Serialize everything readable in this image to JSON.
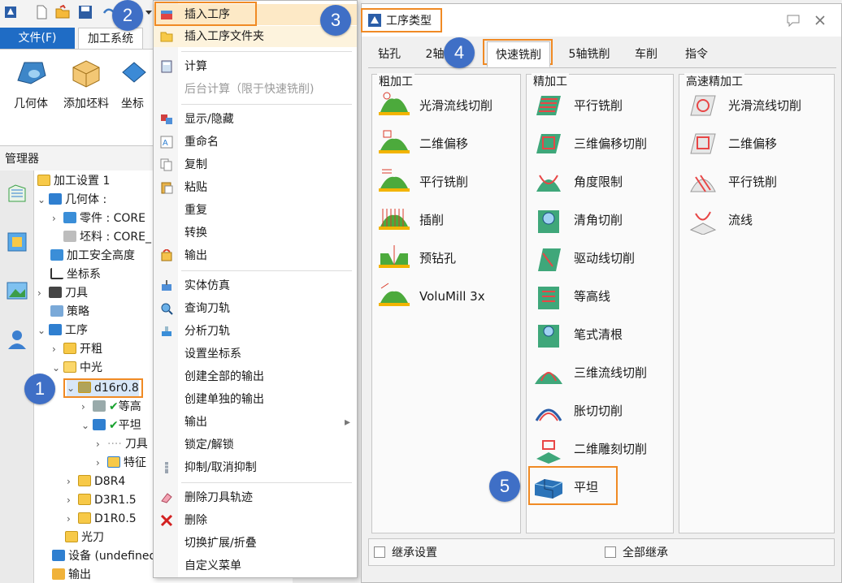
{
  "ribbon": {
    "tabs": [
      "文件(F)",
      "加工系统"
    ],
    "buttons": [
      "几何体",
      "添加坯料",
      "坐标"
    ]
  },
  "manager": {
    "title": "管理器",
    "tree": [
      "加工设置 1",
      "几何体 :",
      "零件 : CORE",
      "坯料 : CORE_",
      "加工安全高度",
      "坐标系",
      "刀具",
      "策略",
      "工序",
      "开粗",
      "中光",
      "d16r0.8",
      "等高",
      "平坦",
      "刀具",
      "特征",
      "D8R4",
      "D3R1.5",
      "D1R0.5",
      "光刀",
      "设备 (undefined",
      "输出"
    ]
  },
  "context_menu": {
    "items": [
      {
        "label": "插入工序",
        "icon": "insert-operation-icon",
        "enabled": true
      },
      {
        "label": "插入工序文件夹",
        "icon": "folder-icon",
        "enabled": true
      },
      {
        "label": "计算",
        "icon": "calculator-icon",
        "enabled": true
      },
      {
        "label": "后台计算（限于快速铣削)",
        "icon": "",
        "enabled": false
      },
      {
        "label": "显示/隐藏",
        "icon": "show-hide-icon",
        "enabled": true
      },
      {
        "label": "重命名",
        "icon": "rename-icon",
        "enabled": true
      },
      {
        "label": "复制",
        "icon": "copy-icon",
        "enabled": true
      },
      {
        "label": "粘贴",
        "icon": "paste-icon",
        "enabled": true
      },
      {
        "label": "重复",
        "icon": "",
        "enabled": true
      },
      {
        "label": "转换",
        "icon": "",
        "enabled": true
      },
      {
        "label": "输出",
        "icon": "export-icon",
        "enabled": true
      },
      {
        "label": "实体仿真",
        "icon": "simulation-icon",
        "enabled": true
      },
      {
        "label": "查询刀轨",
        "icon": "query-toolpath-icon",
        "enabled": true
      },
      {
        "label": "分析刀轨",
        "icon": "analyze-toolpath-icon",
        "enabled": true
      },
      {
        "label": "设置坐标系",
        "icon": "",
        "enabled": true
      },
      {
        "label": "创建全部的输出",
        "icon": "",
        "enabled": true
      },
      {
        "label": "创建单独的输出",
        "icon": "",
        "enabled": true
      },
      {
        "label": "输出",
        "icon": "",
        "enabled": true,
        "submenu": true
      },
      {
        "label": "锁定/解锁",
        "icon": "",
        "enabled": true
      },
      {
        "label": "抑制/取消抑制",
        "icon": "suppress-icon",
        "enabled": true
      },
      {
        "label": "删除刀具轨迹",
        "icon": "eraser-icon",
        "enabled": true
      },
      {
        "label": "删除",
        "icon": "delete-icon",
        "enabled": true
      },
      {
        "label": "切换扩展/折叠",
        "icon": "",
        "enabled": true
      },
      {
        "label": "自定义菜单",
        "icon": "",
        "enabled": true
      }
    ],
    "submenu_arrow": "▸"
  },
  "dialog": {
    "title": "工序类型",
    "tabs": [
      "钻孔",
      "2轴",
      "快速铣削",
      "5轴铣削",
      "车削",
      "指令"
    ],
    "active_tab": "快速铣削",
    "groups": {
      "rough": {
        "title": "粗加工",
        "items": [
          "光滑流线切削",
          "二维偏移",
          "平行铣削",
          "插削",
          "预钻孔",
          "VoluMill 3x"
        ]
      },
      "finish": {
        "title": "精加工",
        "items": [
          "平行铣削",
          "三维偏移切削",
          "角度限制",
          "清角切削",
          "驱动线切削",
          "等高线",
          "笔式清根",
          "三维流线切削",
          "胀切切削",
          "二维雕刻切削",
          "平坦"
        ]
      },
      "hsfinish": {
        "title": "高速精加工",
        "items": [
          "光滑流线切削",
          "二维偏移",
          "平行铣削",
          "流线"
        ]
      }
    },
    "checkboxes": [
      {
        "label": "继承设置",
        "checked": false
      },
      {
        "label": "全部继承",
        "checked": false
      }
    ]
  },
  "callouts": [
    "1",
    "2",
    "3",
    "4",
    "5"
  ],
  "colors": {
    "accent": "#1f6cc5",
    "highlight": "#f08a24",
    "callout": "#3f6fc6",
    "check": "#18a12e"
  }
}
